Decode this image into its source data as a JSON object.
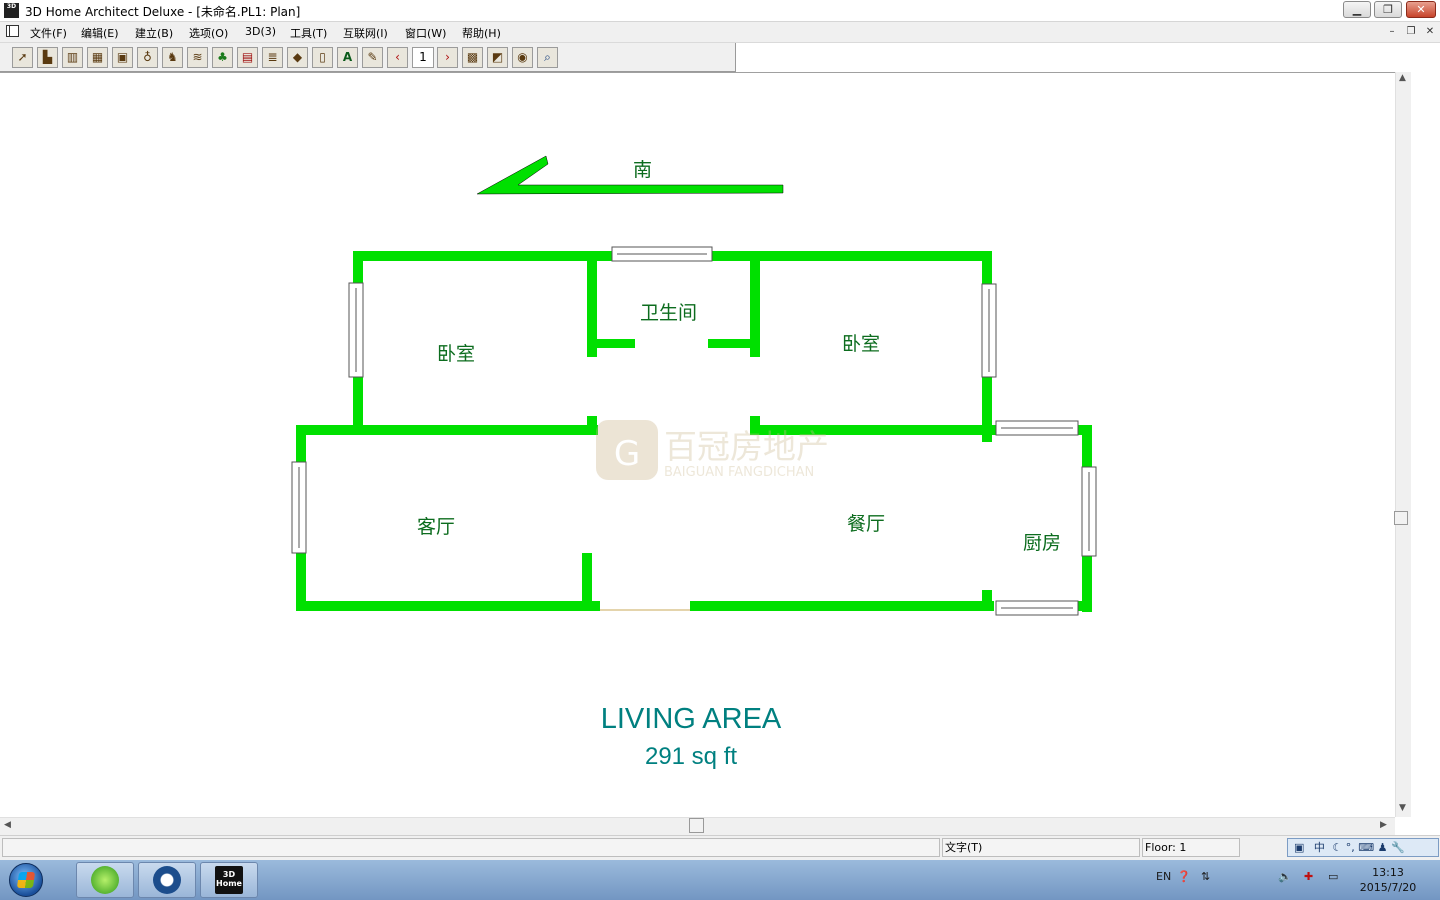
{
  "window": {
    "title": "3D Home Architect Deluxe - [未命名.PL1: Plan]",
    "icon_label": "3D",
    "minimize_label": "▁",
    "restore_label": "❐",
    "close_label": "✕"
  },
  "menu": {
    "items": [
      {
        "label": "文件(F)"
      },
      {
        "label": "编辑(E)"
      },
      {
        "label": "建立(B)"
      },
      {
        "label": "选项(O)"
      },
      {
        "label": "3D(3)"
      },
      {
        "label": "工具(T)"
      },
      {
        "label": "互联网(I)"
      },
      {
        "label": "窗口(W)"
      },
      {
        "label": "帮助(H)"
      }
    ],
    "mdi_minimize": "–",
    "mdi_restore": "❐",
    "mdi_close": "✕"
  },
  "toolbar": {
    "floor_value": "1",
    "text_tool_label": "A",
    "prev_floor": "‹",
    "next_floor": "›"
  },
  "plan": {
    "compass_label": "南",
    "rooms": {
      "bedroom_left": "卧室",
      "bathroom": "卫生间",
      "bedroom_right": "卧室",
      "living_room": "客厅",
      "dining_room": "餐厅",
      "kitchen": "厨房"
    },
    "wall_color": "#00e000",
    "watermark_cn": "百冠房地产",
    "watermark_en": "BAIGUAN FANGDICHAN",
    "living_area_title": "LIVING AREA",
    "living_area_value": "291 sq ft"
  },
  "status": {
    "mode": "文字(T)",
    "floor": "Floor: 1"
  },
  "ime": {
    "lang": "中",
    "items": "☾ °, ⌨ ♟ 🔧"
  },
  "tray": {
    "lang": "EN",
    "time": "13:13",
    "date": "2015/7/20"
  },
  "taskbar": {
    "app3d_label": "3D Home"
  }
}
